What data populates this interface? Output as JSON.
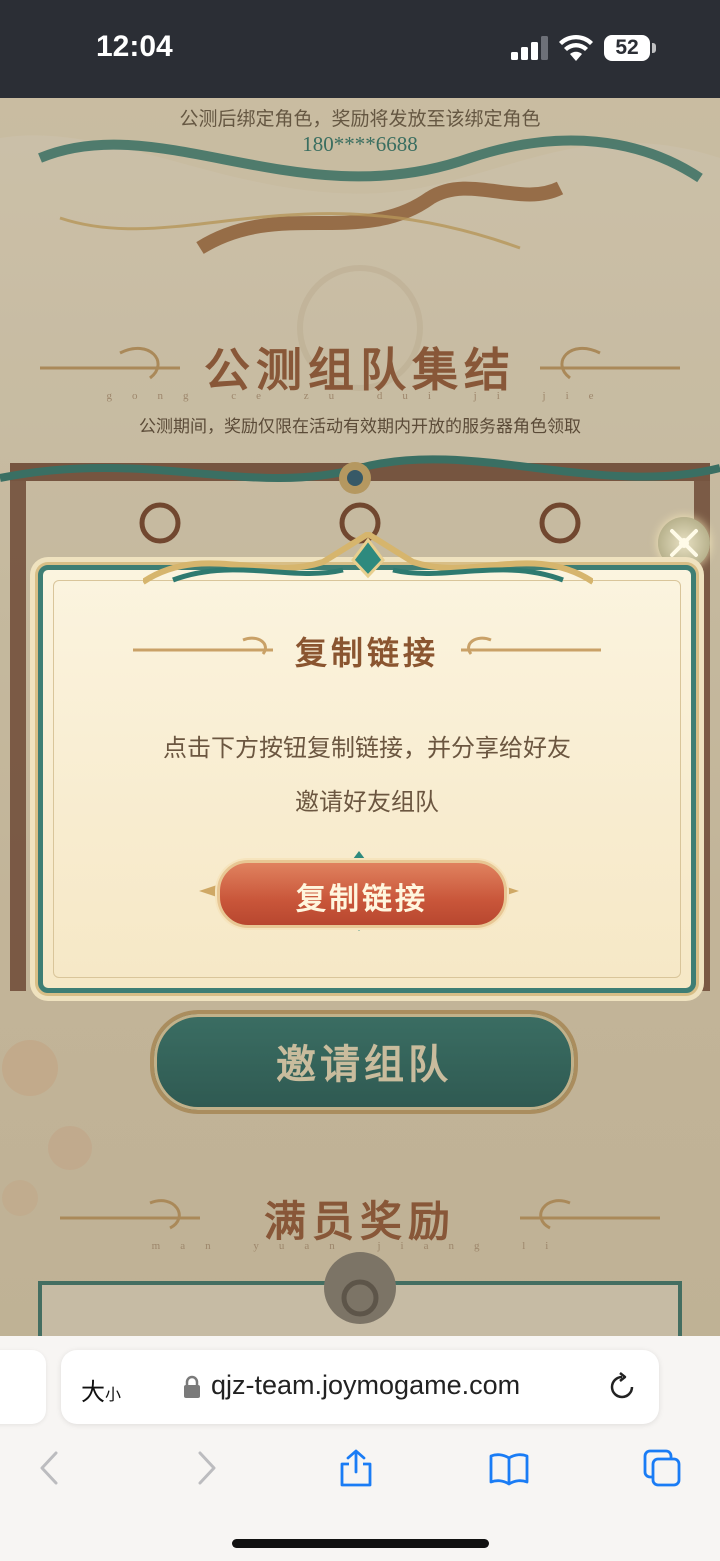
{
  "status_bar": {
    "time": "12:04",
    "battery": "52"
  },
  "page": {
    "bind_note": "公测后绑定角色，奖励将发放至该绑定角色",
    "phone_number": "180****6688",
    "section1": {
      "title": "公测组队集结",
      "pinyin": "gong ce zu dui ji jie",
      "note": "公测期间，奖励仅限在活动有效期内开放的服务器角色领取"
    },
    "invite_button": "邀请组队",
    "section2": {
      "title": "满员奖励",
      "pinyin": "man yuan jiang li"
    }
  },
  "modal": {
    "title": "复制链接",
    "line1": "点击下方按钮复制链接，并分享给好友",
    "line2": "邀请好友组队",
    "copy_button": "复制链接",
    "close_icon": "close-x-icon"
  },
  "browser": {
    "text_size_big": "大",
    "text_size_small": "小",
    "url": "qjz-team.joymogame.com"
  },
  "colors": {
    "teal": "#2f7a72",
    "copy_button": "#c9563a",
    "title_brown": "#8a5530",
    "ios_blue": "#1a7cf5"
  }
}
